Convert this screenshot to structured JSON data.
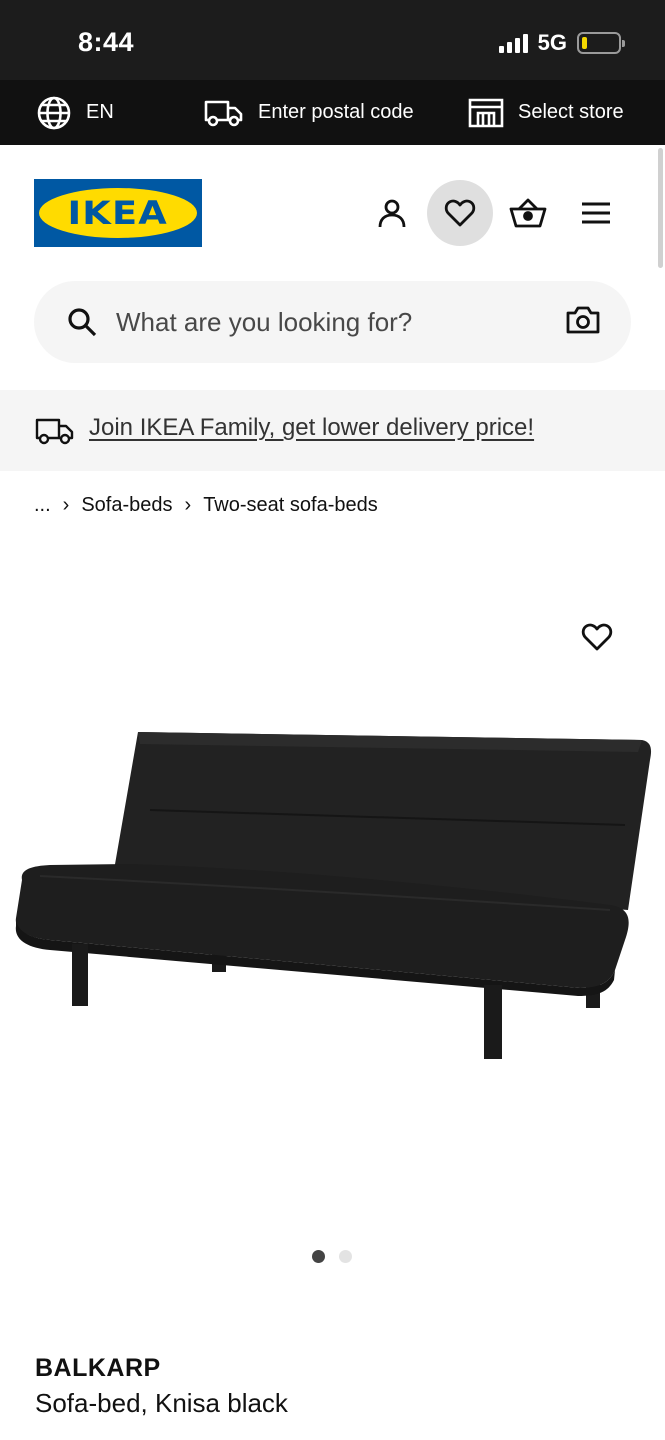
{
  "status_bar": {
    "time": "8:44",
    "network": "5G",
    "battery_level": 0.15,
    "signal_bars": 3
  },
  "top_bar": {
    "language": "EN",
    "postal_label": "Enter postal code",
    "store_label": "Select store"
  },
  "header": {
    "logo_text": "IKEA",
    "icons": [
      "profile-icon",
      "heart-icon",
      "basket-icon",
      "menu-icon"
    ]
  },
  "search": {
    "placeholder": "What are you looking for?"
  },
  "promo": {
    "text": "Join IKEA Family, get lower delivery price!"
  },
  "breadcrumb": {
    "ellipsis": "...",
    "items": [
      "Sofa-beds",
      "Two-seat sofa-beds"
    ],
    "separator": "›"
  },
  "gallery": {
    "current_image": 1,
    "total_images": 2
  },
  "product": {
    "name": "BALKARP",
    "description": "Sofa-bed, Knisa black"
  },
  "colors": {
    "ikea_blue": "#0058a3",
    "ikea_yellow": "#ffdb00",
    "top_bar": "#111111",
    "light_gray": "#f5f5f5"
  }
}
